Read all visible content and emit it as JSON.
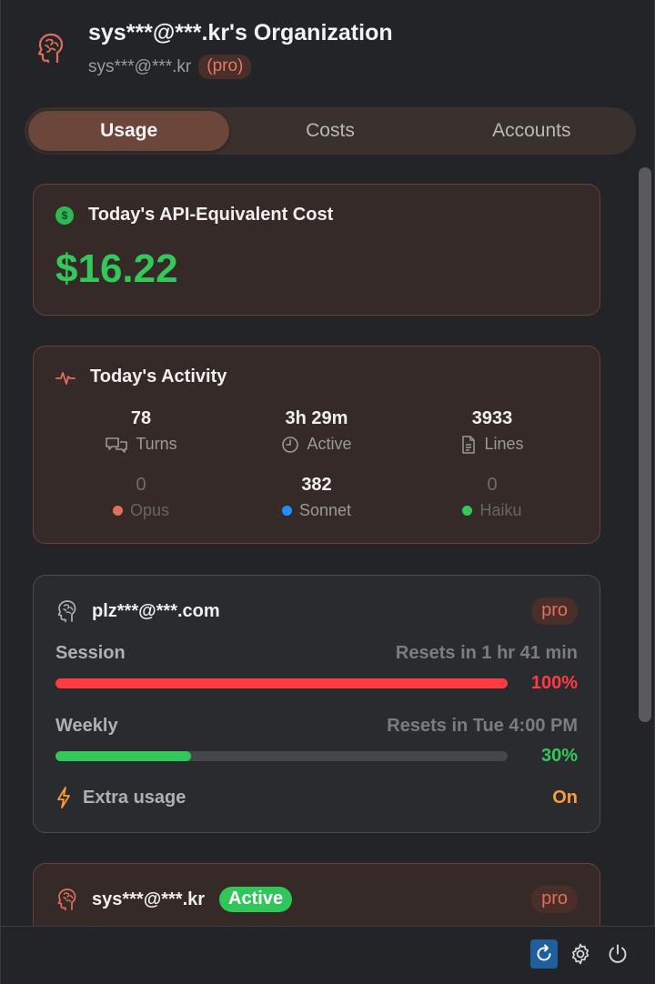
{
  "header": {
    "title": "sys***@***.kr's Organization",
    "email": "sys***@***.kr",
    "plan": "(pro)"
  },
  "tabs": [
    {
      "label": "Usage",
      "active": true
    },
    {
      "label": "Costs",
      "active": false
    },
    {
      "label": "Accounts",
      "active": false
    }
  ],
  "cost": {
    "title": "Today's API-Equivalent Cost",
    "value": "$16.22",
    "icon": "dollar-circle-icon"
  },
  "activity": {
    "title": "Today's Activity",
    "stats": [
      {
        "value": "78",
        "label": "Turns",
        "icon": "chat-bubbles-icon"
      },
      {
        "value": "3h 29m",
        "label": "Active",
        "icon": "clock-icon"
      },
      {
        "value": "3933",
        "label": "Lines",
        "icon": "document-icon"
      }
    ],
    "models": [
      {
        "value": "0",
        "label": "Opus",
        "color": "#e0705c"
      },
      {
        "value": "382",
        "label": "Sonnet",
        "color": "#1e90ff"
      },
      {
        "value": "0",
        "label": "Haiku",
        "color": "#34c759"
      }
    ]
  },
  "accounts": [
    {
      "email": "plz***@***.com",
      "plan": "pro",
      "session": {
        "label": "Session",
        "reset": "Resets in 1 hr 41 min",
        "percent_text": "100%",
        "fraction": 1.0,
        "color": "#ff3b41"
      },
      "weekly": {
        "label": "Weekly",
        "reset": "Resets in Tue 4:00 PM",
        "percent_text": "30%",
        "fraction": 0.3,
        "color": "#34c759"
      },
      "extra": {
        "label": "Extra usage",
        "state": "On"
      }
    },
    {
      "email": "sys***@***.kr",
      "status": "Active",
      "plan": "pro"
    }
  ],
  "footer": {
    "buttons": [
      "refresh-icon",
      "settings-icon",
      "power-icon"
    ]
  }
}
